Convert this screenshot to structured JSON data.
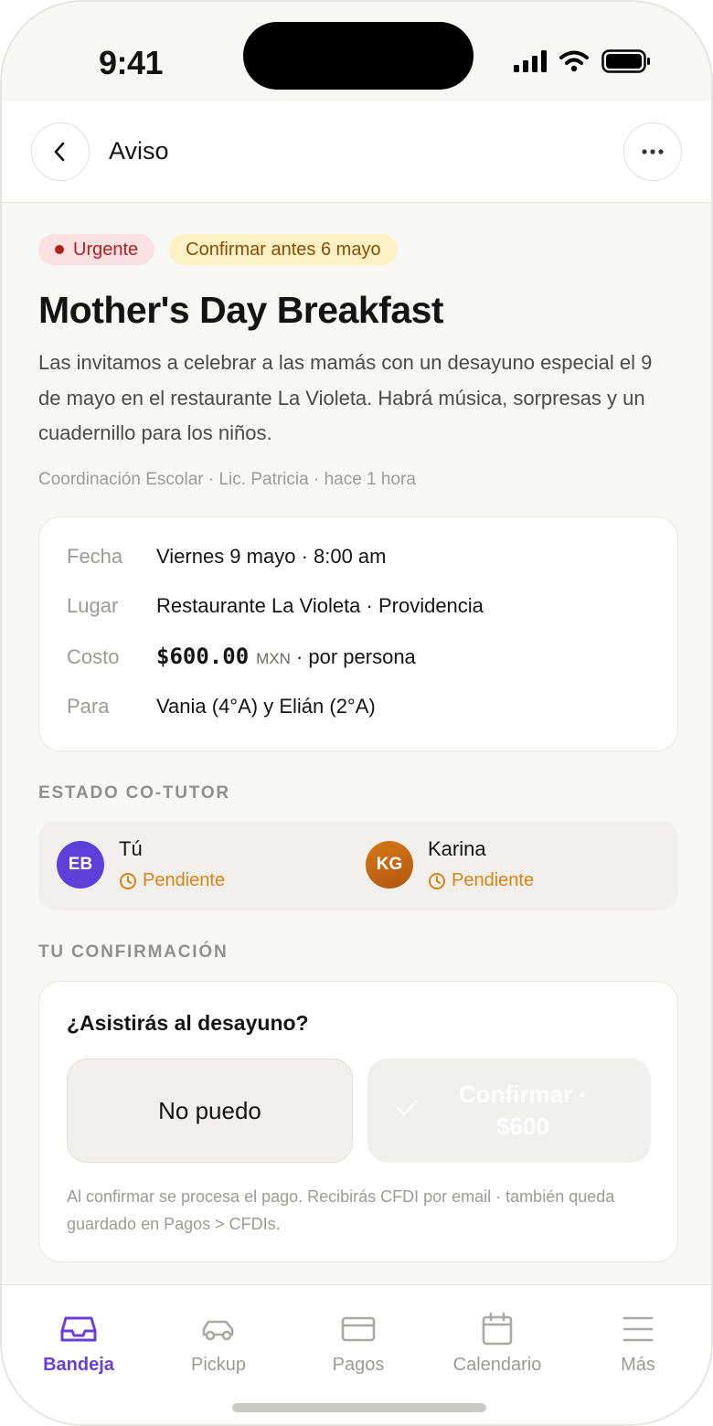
{
  "status_bar": {
    "time": "9:41"
  },
  "header": {
    "title": "Aviso",
    "back_icon": "chevron-left-icon",
    "more_icon": "ellipsis-icon"
  },
  "notice": {
    "badges": {
      "urgent": "Urgente",
      "deadline": "Confirmar antes 6 mayo"
    },
    "title": "Mother's Day Breakfast",
    "description": "Las invitamos a celebrar a las mamás con un desayuno especial el 9 de mayo en el restaurante La Violeta. Habrá música, sorpresas y un cuadernillo para los niños.",
    "meta": "Coordinación Escolar · Lic. Patricia · hace 1 hora"
  },
  "details": {
    "date": {
      "label": "Fecha",
      "value": "Viernes 9 mayo · 8:00 am"
    },
    "place": {
      "label": "Lugar",
      "value": "Restaurante La Violeta · Providencia"
    },
    "cost": {
      "label": "Costo",
      "amount": "$600.00",
      "currency": "MXN",
      "suffix": "· por persona"
    },
    "for": {
      "label": "Para",
      "value": "Vania (4°A) y Elián (2°A)"
    }
  },
  "cotutor": {
    "section_label": "ESTADO CO-TUTOR",
    "people": [
      {
        "initials": "EB",
        "name": "Tú",
        "status": "Pendiente",
        "color": "#5b3fd9"
      },
      {
        "initials": "KG",
        "name": "Karina",
        "status": "Pendiente",
        "color": "#c86410"
      }
    ]
  },
  "confirmation": {
    "section_label": "TU CONFIRMACIÓN",
    "question": "¿Asistirás al desayuno?",
    "decline_label": "No puedo",
    "confirm_label": "Confirmar · $600",
    "note": "Al confirmar se procesa el pago. Recibirás CFDI por email · también queda guardado en Pagos > CFDIs."
  },
  "tabs": [
    {
      "label": "Bandeja",
      "icon": "inbox-icon",
      "active": true
    },
    {
      "label": "Pickup",
      "icon": "car-icon",
      "active": false
    },
    {
      "label": "Pagos",
      "icon": "credit-card-icon",
      "active": false
    },
    {
      "label": "Calendario",
      "icon": "calendar-icon",
      "active": false
    },
    {
      "label": "Más",
      "icon": "menu-icon",
      "active": false
    }
  ],
  "colors": {
    "accent": "#6a3fd6",
    "urgent": "#b0201e",
    "pending": "#d88410"
  }
}
